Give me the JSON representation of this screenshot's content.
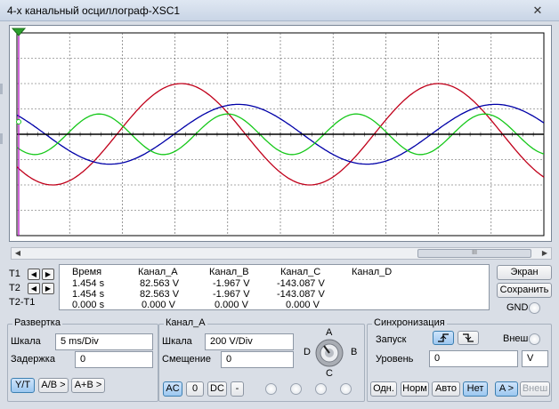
{
  "window": {
    "title": "4-х канальный осциллограф-XSC1",
    "close": "✕"
  },
  "cursors": {
    "t1": "T1",
    "t2": "T2",
    "diff": "T2-T1"
  },
  "readout": {
    "headers": [
      "Время",
      "Канал_A",
      "Канал_B",
      "Канал_C",
      "Канал_D"
    ],
    "rows": [
      [
        "1.454 s",
        "82.563 V",
        "-1.967 V",
        "-143.087 V"
      ],
      [
        "1.454 s",
        "82.563 V",
        "-1.967 V",
        "-143.087 V"
      ],
      [
        "0.000 s",
        "0.000 V",
        "0.000 V",
        "0.000 V"
      ]
    ]
  },
  "right_buttons": {
    "screen": "Экран",
    "save": "Сохранить",
    "gnd": "GND"
  },
  "timebase": {
    "title": "Развертка",
    "scale_label": "Шкала",
    "scale_value": "5 ms/Div",
    "delay_label": "Задержка",
    "delay_value": "0",
    "mode_yt": "Y/T",
    "mode_ab": "A/B >",
    "mode_apb": "A+B >"
  },
  "channel": {
    "title": "Канал_A",
    "scale_label": "Шкала",
    "scale_value": "200  V/Div",
    "offset_label": "Смещение",
    "offset_value": "0",
    "coupling_ac": "AC",
    "coupling_0": "0",
    "coupling_dc": "DC",
    "coupling_minus": "-",
    "knob_labels": {
      "a": "A",
      "b": "B",
      "c": "C",
      "d": "D"
    }
  },
  "trigger": {
    "title": "Синхронизация",
    "start_label": "Запуск",
    "external_label": "Внеш",
    "level_label": "Уровень",
    "level_value": "0",
    "level_unit": "V",
    "mode_single": "Одн.",
    "mode_normal": "Норм",
    "mode_auto": "Авто",
    "mode_none": "Нет",
    "source_a": "A >",
    "source_ext": "Внеш"
  },
  "colors": {
    "channel_a": "#c0001a",
    "channel_b": "#16c81a",
    "channel_c": "#0000a8",
    "channel_d": "#000000",
    "cursor_t1": "#b000c0"
  },
  "chart_data": {
    "type": "line",
    "x": {
      "divisions": 10,
      "time_per_div_ms": 5
    },
    "ylim_divisions": [
      -4,
      4
    ],
    "grid": true,
    "series": [
      {
        "color": "#c0001a",
        "amplitude_div": 2.0,
        "period_div": 4.88,
        "phase_deg": 220
      },
      {
        "color": "#0000a8",
        "amplitude_div": 1.18,
        "period_div": 4.88,
        "phase_deg": 140
      },
      {
        "color": "#16c81a",
        "amplitude_div": 0.8,
        "period_div": 2.44,
        "phase_deg": 220
      },
      {
        "color": "#000000",
        "amplitude_div": 0.0,
        "period_div": 4.88,
        "phase_deg": 0
      }
    ]
  }
}
